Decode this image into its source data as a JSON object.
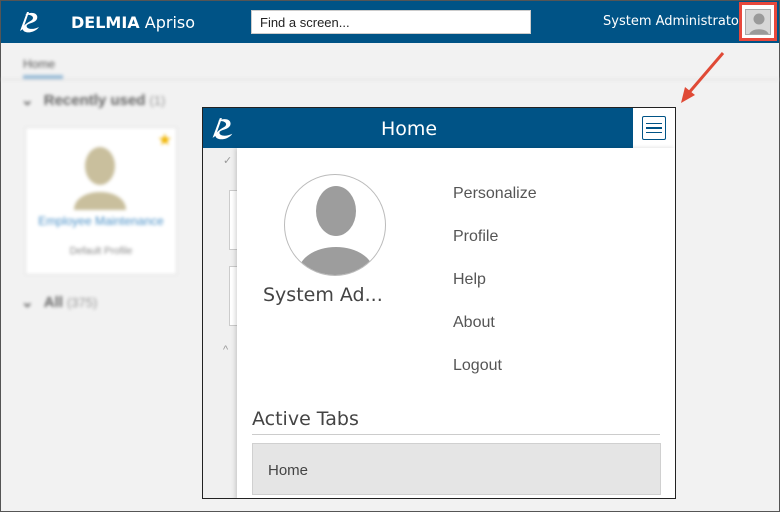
{
  "topbar": {
    "brand_bold": "DELMIA",
    "brand_light": " Apriso",
    "search_placeholder": "Find a screen...",
    "user_name": "System Administrator",
    "logo_icon": "3ds-logo-icon",
    "avatar_icon": "user-avatar-icon"
  },
  "background": {
    "breadcrumb": "Home",
    "recent_section": "Recently used",
    "recent_count": "(1)",
    "card_title": "Employee Maintenance",
    "card_subtitle": "Default Profile",
    "all_section": "All",
    "all_count": "(375)"
  },
  "popup": {
    "title": "Home",
    "menu_icon": "hamburger-menu-icon",
    "profile_name": "System Ad...",
    "menu_items": [
      "Personalize",
      "Profile",
      "Help",
      "About",
      "Logout"
    ],
    "active_tabs_title": "Active Tabs",
    "active_tabs": [
      "Home"
    ]
  },
  "colors": {
    "brand_blue": "#005386",
    "highlight_red": "#e8483c",
    "arrow_red": "#e04a36"
  }
}
